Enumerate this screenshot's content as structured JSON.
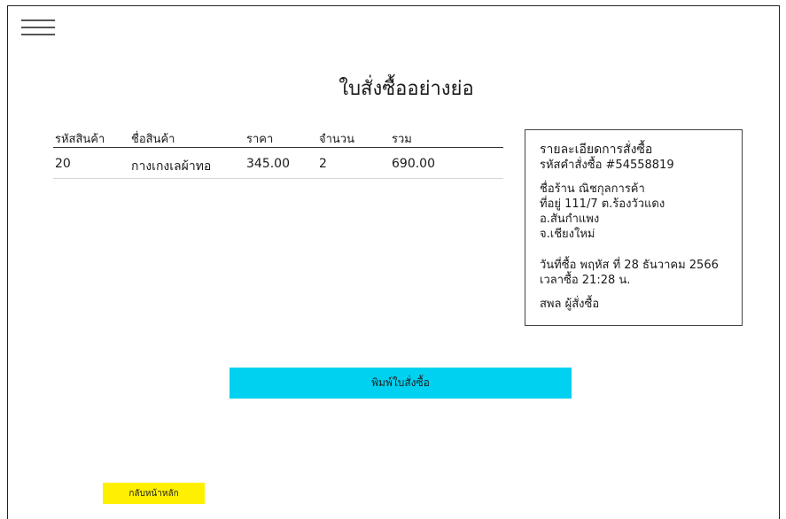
{
  "page": {
    "title": "ใบสั่งซื้ออย่างย่อ"
  },
  "table": {
    "headers": [
      "รหัสสินค้า",
      "ชื่อสินค้า",
      "ราคา",
      "จำนวน",
      "รวม"
    ],
    "rows": [
      {
        "code": "20",
        "name": "กางเกงเลผ้าทอ",
        "price": "345.00",
        "qty": "2",
        "total": "690.00"
      }
    ]
  },
  "details": {
    "heading": "รายละเอียดการสั่งซื้อ",
    "order_id": "รหัสคำสั่งซื้อ #54558819",
    "shop_name": "ชื่อร้าน ณิชกุลการค้า",
    "address_line1": "ที่อยู่ 111/7 ต.ร้องวัวแดง อ.สันกำแพง",
    "address_line2": "จ.เชียงใหม่",
    "order_date": "วันที่ซื้อ พฤหัส ที่ 28 ธันวาคม 2566",
    "order_time": "เวลาซื้อ 21:28 น.",
    "orderer": "สพล ผู้สั่งซื้อ"
  },
  "buttons": {
    "print": "พิมพ์ใบสั่งซื้อ",
    "home": "กลับหน้าหลัก"
  },
  "colors": {
    "print_button": "#00d1f0",
    "home_button": "#ffef00"
  },
  "icons": {
    "menu": "hamburger-menu-icon"
  }
}
